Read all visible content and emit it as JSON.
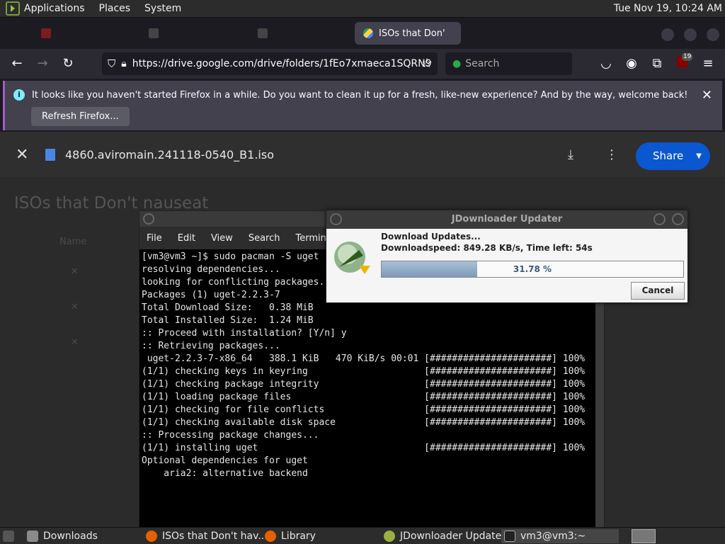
{
  "top_panel": {
    "menus": [
      "Applications",
      "Places",
      "System"
    ],
    "clock": "Tue Nov 19, 10:24 AM"
  },
  "browser": {
    "active_tab_title": "ISOs that Don'",
    "url": "https://drive.google.com/drive/folders/1fEo7xmaeca1SQRN9",
    "search_placeholder": "Search",
    "ublock_badge": "19"
  },
  "notification": {
    "message": "It looks like you haven't started Firefox in a while. Do you want to clean it up for a fresh, like-new experience? And by the way, welcome back!",
    "button": "Refresh Firefox..."
  },
  "drive": {
    "file_name": "4860.aviromain.241118-0540_B1.iso",
    "share_label": "Share",
    "folder_heading": "ISOs that Don't nauseat"
  },
  "terminal": {
    "menu": [
      "File",
      "Edit",
      "View",
      "Search",
      "Terminal"
    ],
    "lines": [
      "[vm3@vm3 ~]$ sudo pacman -S uget",
      "resolving dependencies...",
      "looking for conflicting packages...",
      "",
      "Packages (1) uget-2.2.3-7",
      "",
      "Total Download Size:   0.38 MiB",
      "Total Installed Size:  1.24 MiB",
      "",
      ":: Proceed with installation? [Y/n] y",
      ":: Retrieving packages...",
      " uget-2.2.3-7-x86_64   388.1 KiB   470 KiB/s 00:01 [######################] 100%",
      "(1/1) checking keys in keyring                     [######################] 100%",
      "(1/1) checking package integrity                   [######################] 100%",
      "(1/1) loading package files                        [######################] 100%",
      "(1/1) checking for file conflicts                  [######################] 100%",
      "(1/1) checking available disk space                [######################] 100%",
      ":: Processing package changes...",
      "(1/1) installing uget                              [######################] 100%",
      "Optional dependencies for uget",
      "    aria2: alternative backend"
    ]
  },
  "jdownloader": {
    "title": "JDownloader Updater",
    "line1": "Download Updates...",
    "line2": "Downloadspeed: 849.28 KB/s, Time left: 54s",
    "progress_percent": 31.78,
    "progress_label": "31.78 %",
    "cancel_label": "Cancel"
  },
  "taskbar": {
    "items": [
      "Downloads",
      "ISOs that Don't hav...",
      "Library",
      "JDownloader Updater",
      "vm3@vm3:~"
    ]
  }
}
